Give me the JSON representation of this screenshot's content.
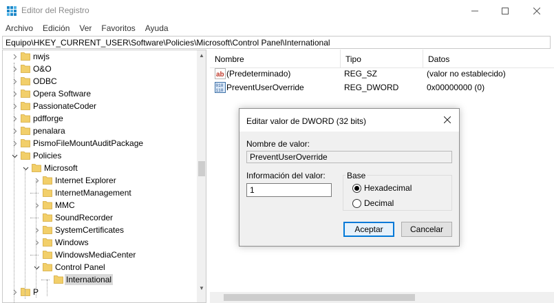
{
  "window": {
    "title": "Editor del Registro",
    "controls": {
      "minimize": "—",
      "maximize": "☐",
      "close": "✕"
    }
  },
  "menu": [
    "Archivo",
    "Edición",
    "Ver",
    "Favoritos",
    "Ayuda"
  ],
  "address": "Equipo\\HKEY_CURRENT_USER\\Software\\Policies\\Microsoft\\Control Panel\\International",
  "tree": {
    "items": [
      {
        "label": "nwjs",
        "depth": 0,
        "expand": "collapsed"
      },
      {
        "label": "O&O",
        "depth": 0,
        "expand": "collapsed"
      },
      {
        "label": "ODBC",
        "depth": 0,
        "expand": "collapsed"
      },
      {
        "label": "Opera Software",
        "depth": 0,
        "expand": "collapsed"
      },
      {
        "label": "PassionateCoder",
        "depth": 0,
        "expand": "collapsed"
      },
      {
        "label": "pdfforge",
        "depth": 0,
        "expand": "collapsed"
      },
      {
        "label": "penalara",
        "depth": 0,
        "expand": "collapsed"
      },
      {
        "label": "PismoFileMountAuditPackage",
        "depth": 0,
        "expand": "collapsed"
      },
      {
        "label": "Policies",
        "depth": 0,
        "expand": "expanded"
      },
      {
        "label": "Microsoft",
        "depth": 1,
        "expand": "expanded"
      },
      {
        "label": "Internet Explorer",
        "depth": 2,
        "expand": "collapsed"
      },
      {
        "label": "InternetManagement",
        "depth": 2,
        "expand": "none"
      },
      {
        "label": "MMC",
        "depth": 2,
        "expand": "collapsed"
      },
      {
        "label": "SoundRecorder",
        "depth": 2,
        "expand": "none"
      },
      {
        "label": "SystemCertificates",
        "depth": 2,
        "expand": "collapsed"
      },
      {
        "label": "Windows",
        "depth": 2,
        "expand": "collapsed"
      },
      {
        "label": "WindowsMediaCenter",
        "depth": 2,
        "expand": "none"
      },
      {
        "label": "Control Panel",
        "depth": 2,
        "expand": "expanded"
      },
      {
        "label": "International",
        "depth": 3,
        "expand": "none",
        "selected": true
      },
      {
        "label": "P",
        "depth": 0,
        "expand": "collapsed"
      }
    ]
  },
  "values": {
    "columns": {
      "name": "Nombre",
      "type": "Tipo",
      "data": "Datos"
    },
    "rows": [
      {
        "icon": "string-value-icon",
        "name": "(Predeterminado)",
        "type": "REG_SZ",
        "data": "(valor no establecido)"
      },
      {
        "icon": "binary-value-icon",
        "name": "PreventUserOverride",
        "type": "REG_DWORD",
        "data": "0x00000000 (0)"
      }
    ]
  },
  "dialog": {
    "title": "Editar valor de DWORD (32 bits)",
    "value_name_label": "Nombre de valor:",
    "value_name": "PreventUserOverride",
    "value_data_label": "Información del valor:",
    "value_data": "1",
    "base_label": "Base",
    "hex_label": "Hexadecimal",
    "dec_label": "Decimal",
    "base_selected": "hex",
    "ok_label": "Aceptar",
    "cancel_label": "Cancelar"
  },
  "colors": {
    "folder": "#f2cf6a",
    "accent": "#0078d7"
  }
}
